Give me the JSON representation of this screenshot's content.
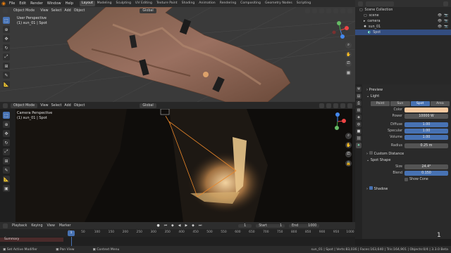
{
  "topbar": {
    "menus": [
      "File",
      "Edit",
      "Render",
      "Window",
      "Help"
    ],
    "workspaces": [
      "Layout",
      "Modeling",
      "Sculpting",
      "UV Editing",
      "Texture Paint",
      "Shading",
      "Animation",
      "Rendering",
      "Compositing",
      "Geometry Nodes",
      "Scripting"
    ],
    "active_workspace": "Layout",
    "scene_label": "Scene",
    "viewlayer_label": "ViewLayer"
  },
  "viewport_top": {
    "mode": "Object Mode",
    "menus": [
      "View",
      "Select",
      "Add",
      "Object"
    ],
    "orientation": "Global",
    "label_line1": "User Perspective",
    "label_line2": "(1) sun_01 | Spot"
  },
  "viewport_bottom": {
    "mode": "Object Mode",
    "menus": [
      "View",
      "Select",
      "Add",
      "Object"
    ],
    "orientation": "Global",
    "label_line1": "Camera Perspective",
    "label_line2": "(1) sun_01 | Spot"
  },
  "outliner": {
    "title": "Scene Collection",
    "rows": [
      {
        "label": "Scene Collection",
        "selected": false
      },
      {
        "label": "scene",
        "selected": false
      },
      {
        "label": "camera",
        "selected": false
      },
      {
        "label": "sun_01",
        "selected": false
      },
      {
        "label": "Spot",
        "selected": true
      }
    ]
  },
  "properties": {
    "preview_label": "Preview",
    "light_label": "Light",
    "light_types": [
      "Point",
      "Sun",
      "Spot",
      "Area"
    ],
    "active_light_type": "Spot",
    "fields": [
      {
        "label": "Color",
        "value": ""
      },
      {
        "label": "Power",
        "value": "10000 W"
      },
      {
        "label": "Diffuse",
        "value": "1.00"
      },
      {
        "label": "Specular",
        "value": "1.00"
      },
      {
        "label": "Volume",
        "value": "1.00"
      },
      {
        "label": "Radius",
        "value": "0.25 m"
      }
    ],
    "custom_distance_label": "Custom Distance",
    "spot_shape_label": "Spot Shape",
    "spot_fields": [
      {
        "label": "Size",
        "value": "24.4°"
      },
      {
        "label": "Blend",
        "value": "0.150"
      }
    ],
    "show_cone_label": "Show Cone",
    "shadow_label": "Shadow",
    "color_hex": "#f6c9a0"
  },
  "timeline": {
    "menus": [
      "Playback",
      "Keying",
      "View",
      "Marker"
    ],
    "current_frame": "1",
    "start_label": "Start",
    "start_value": "1",
    "end_label": "End",
    "end_value": "1000",
    "ticks": [
      "0",
      "50",
      "100",
      "150",
      "200",
      "250",
      "300",
      "350",
      "400",
      "450",
      "500",
      "550",
      "600",
      "650",
      "700",
      "750",
      "800",
      "850",
      "900",
      "950",
      "1000"
    ],
    "summary_label": "Summary",
    "frame_marker": "1"
  },
  "statusbar": {
    "left": "Set Active Modifier",
    "middle1": "Pan View",
    "middle2": "Context Menu",
    "right": "sun_01 | Spot | Verts:83,036 | Faces:163,640 | Tris:164,901 | Objects:0/4 | 3.3.0 Beta"
  },
  "corner_number": "1",
  "colors": {
    "accent": "#4772b3",
    "brand": "#e87d0d"
  }
}
